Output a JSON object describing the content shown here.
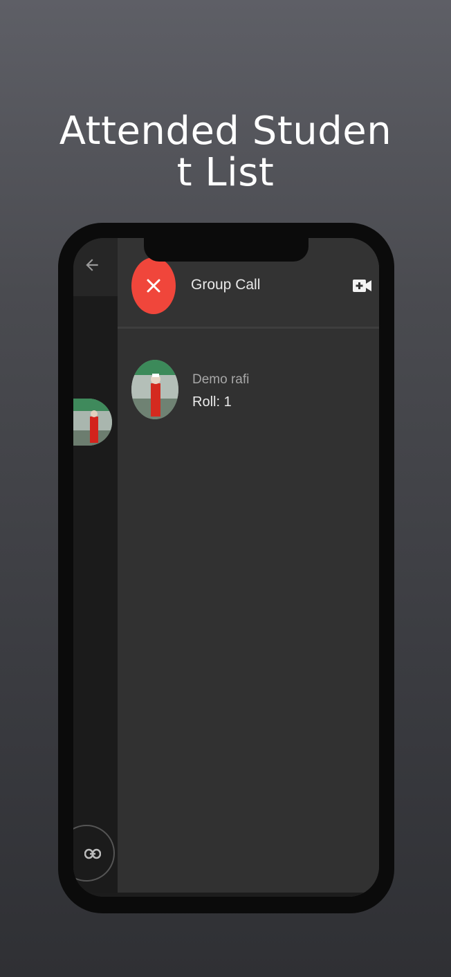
{
  "headline": {
    "line1": "Attended Studen",
    "line2": "t List"
  },
  "appbar": {
    "title": "Group Call",
    "close_icon": "close-icon",
    "video_icon": "video-call-icon"
  },
  "back_screen": {
    "back_icon": "arrow-left-icon",
    "link_icon": "link-icon"
  },
  "students": [
    {
      "name": "Demo rafi",
      "roll": "Roll: 1"
    }
  ],
  "colors": {
    "accent_red": "#f0463b",
    "panel_bg": "#313131"
  }
}
